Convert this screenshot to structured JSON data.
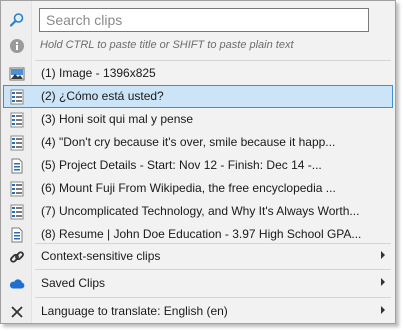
{
  "search": {
    "placeholder": "Search clips",
    "hint": "Hold CTRL to paste title or SHIFT to paste plain text"
  },
  "clips": [
    {
      "label": "(1) Image - 1396x825",
      "icon": "image-icon"
    },
    {
      "label": "(2) ¿Cómo está usted?",
      "icon": "text-clip-icon",
      "selected": true
    },
    {
      "label": "(3) Honi soit qui mal y pense",
      "icon": "text-clip-icon"
    },
    {
      "label": "(4) \"Don't cry because it's over, smile because it happ...",
      "icon": "text-clip-icon"
    },
    {
      "label": "(5) Project Details  - Start: Nov 12 - Finish: Dec 14 -...",
      "icon": "document-icon"
    },
    {
      "label": "(6) Mount Fuji From Wikipedia, the free encyclopedia  ...",
      "icon": "text-clip-icon"
    },
    {
      "label": "(7) Uncomplicated Technology, and Why It's Always Worth...",
      "icon": "text-clip-icon"
    },
    {
      "label": "(8) Resume | John Doe  Education - 3.97 High School GPA...",
      "icon": "document-icon"
    }
  ],
  "submenus": {
    "context_clips": "Context-sensitive clips",
    "saved_clips": "Saved Clips",
    "language": "Language to translate: English (en)"
  },
  "colors": {
    "selection_bg": "#cce4f7",
    "selection_border": "#3f8fd8",
    "cloud": "#1e6fd0"
  }
}
